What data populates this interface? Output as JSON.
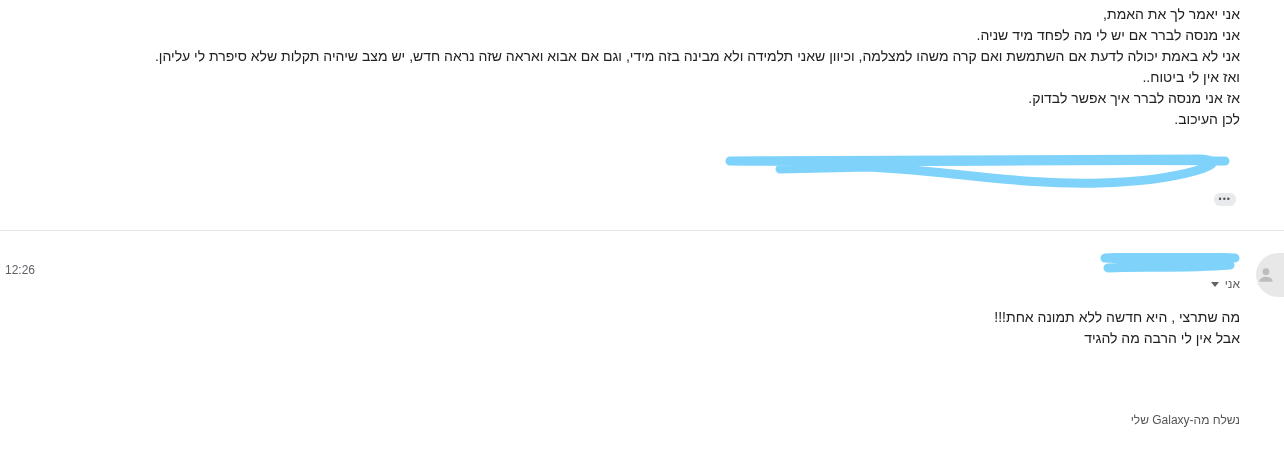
{
  "quoted_message": {
    "lines": [
      "אני יאמר לך את האמת,",
      "אני מנסה לברר אם יש לי מה לפחד מיד שניה.",
      "אני לא באמת יכולה לדעת אם השתמשת ואם קרה משהו למצלמה, וכיוון שאני תלמידה ולא מבינה בזה מידי, וגם אם אבוא ואראה שזה נראה חדש, יש מצב שיהיה תקלות שלא סיפרת לי עליהן.",
      "ואז אין לי ביטוח..",
      "אז אני מנסה לברר איך אפשר לבדוק.",
      "לכן העיכוב."
    ],
    "show_trimmed": "•••"
  },
  "reply": {
    "time": "12:26",
    "recipient": "אני",
    "body": [
      "מה שתרצי , היא חדשה ללא תמונה אחת!!!",
      "אבל אין לי הרבה מה להגיד"
    ],
    "signature": "נשלח מה-Galaxy שלי"
  }
}
